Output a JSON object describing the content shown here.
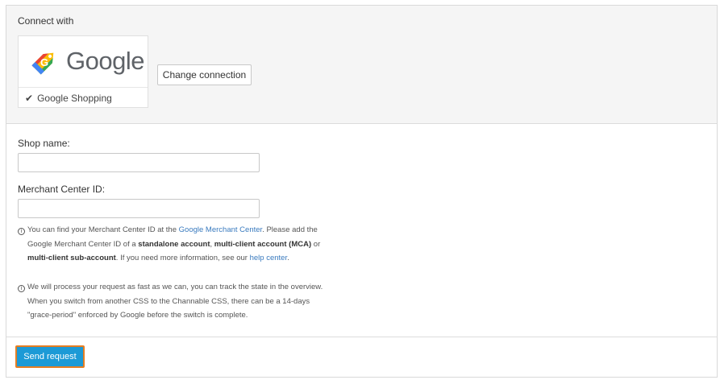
{
  "connect": {
    "title": "Connect with",
    "provider_logo_text": "Google",
    "provider_name": "Google Shopping",
    "change_button": "Change connection"
  },
  "form": {
    "shop_name_label": "Shop name:",
    "shop_name_value": "",
    "merchant_id_label": "Merchant Center ID:",
    "merchant_id_value": ""
  },
  "info1": {
    "t1": "You can find your Merchant Center ID at the ",
    "link1": "Google Merchant Center",
    "t2": ". Please add the",
    "t3": "Google Merchant Center ID of a ",
    "b1": "standalone account",
    "t4": ", ",
    "b2": "multi-client account (MCA)",
    "t5": " or",
    "b3": "multi-client sub-account",
    "t6": ". If you need more information, see our ",
    "link2": "help center",
    "t7": "."
  },
  "info2": {
    "line1": "We will process your request as fast as we can, you can track the state in the overview.",
    "line2": "When you switch from another CSS to the Channable CSS, there can be a 14-days",
    "line3": "\"grace-period\" enforced by Google before the switch is complete."
  },
  "footer": {
    "send_button": "Send request"
  },
  "colors": {
    "send_button_bg": "#1c9ad6",
    "send_button_border": "#e67e22",
    "link": "#3a7bbf"
  }
}
